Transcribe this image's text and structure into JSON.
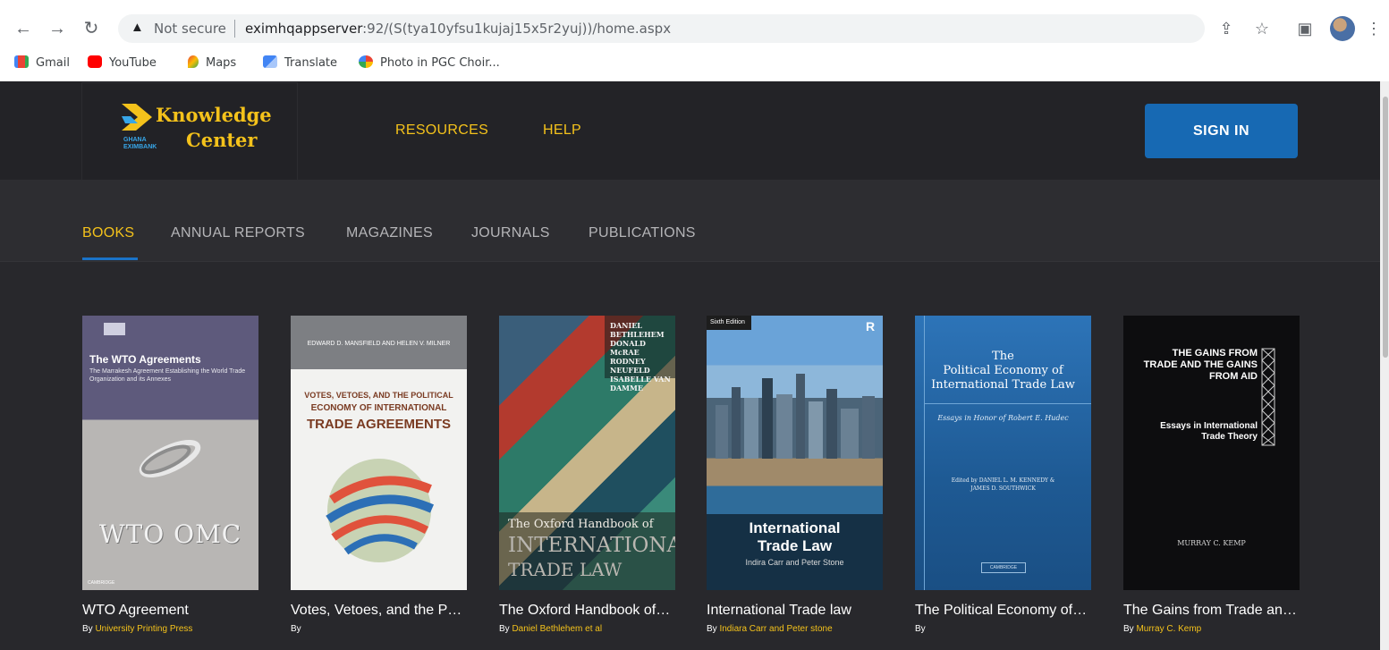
{
  "browser": {
    "security_label": "Not secure",
    "url_host": "eximhqappserver",
    "url_rest": ":92/(S(tya10yfsu1kujaj15x5r2yuj))/home.aspx",
    "bookmarks": [
      {
        "label": "Gmail",
        "color": "#ea4335"
      },
      {
        "label": "YouTube",
        "color": "#ff0000"
      },
      {
        "label": "Maps",
        "color": "#34a853"
      },
      {
        "label": "Translate",
        "color": "#4285f4"
      },
      {
        "label": "Photo in PGC Choir...",
        "color": "#fbbc04"
      }
    ]
  },
  "site": {
    "logo": {
      "line1": "Knowledge",
      "line2": "Center",
      "sub1": "GHANA",
      "sub2": "EXIMBANK"
    },
    "nav": [
      "RESOURCES",
      "HELP"
    ],
    "signin_label": "SIGN IN",
    "tabs": [
      "BOOKS",
      "ANNUAL REPORTS",
      "MAGAZINES",
      "JOURNALS",
      "PUBLICATIONS"
    ],
    "active_tab": "BOOKS",
    "accent": "#f4c21b",
    "button_color": "#1769b3"
  },
  "books": [
    {
      "title": "WTO Agreement",
      "by": "By",
      "author": "University Printing Press",
      "cover": {
        "heading": "The WTO Agreements",
        "subtitle": "The Marrakesh Agreement Establishing the World Trade Organization and its Annexes",
        "logo_text": "WTO OMC",
        "publisher": "CAMBRIDGE"
      }
    },
    {
      "title": "Votes, Vetoes, and the Political Economy of International Trade Agreements",
      "by": "By",
      "author": "",
      "cover": {
        "authors": "EDWARD D. MANSFIELD AND HELEN V. MILNER",
        "line1": "VOTES, VETOES, AND THE POLITICAL",
        "line2": "ECONOMY OF INTERNATIONAL",
        "line3": "TRADE AGREEMENTS"
      }
    },
    {
      "title": "The Oxford Handbook of International Trade Law",
      "by": "By",
      "author": "Daniel Bethlehem et al",
      "cover": {
        "editors": "DANIEL BETHLEHEM DONALD McRAE RODNEY NEUFELD ISABELLE VAN DAMME",
        "line1": "The Oxford Handbook of",
        "line2": "INTERNATIONAL",
        "line3": "TRADE LAW"
      }
    },
    {
      "title": "International Trade law",
      "by": "By",
      "author": "Indiara Carr and Peter stone",
      "cover": {
        "edition": "Sixth Edition",
        "line1": "International",
        "line2": "Trade Law",
        "authors": "Indira Carr and Peter Stone"
      }
    },
    {
      "title": "The Political Economy of International Trade Law",
      "by": "By",
      "author": "",
      "cover": {
        "line1": "The",
        "line2": "Political Economy of",
        "line3": "International Trade Law",
        "subtitle": "Essays in Honor of Robert E. Hudec",
        "editors": "Edited by DANIEL L. M. KENNEDY & JAMES D. SOUTHWICK",
        "publisher": "CAMBRIDGE"
      }
    },
    {
      "title": "The Gains from Trade and the Gains from Aid",
      "by": "By",
      "author": "Murray C. Kemp",
      "cover": {
        "line1": "THE GAINS FROM TRADE AND THE GAINS FROM AID",
        "subtitle": "Essays in International Trade Theory",
        "author": "MURRAY C. KEMP"
      }
    }
  ]
}
